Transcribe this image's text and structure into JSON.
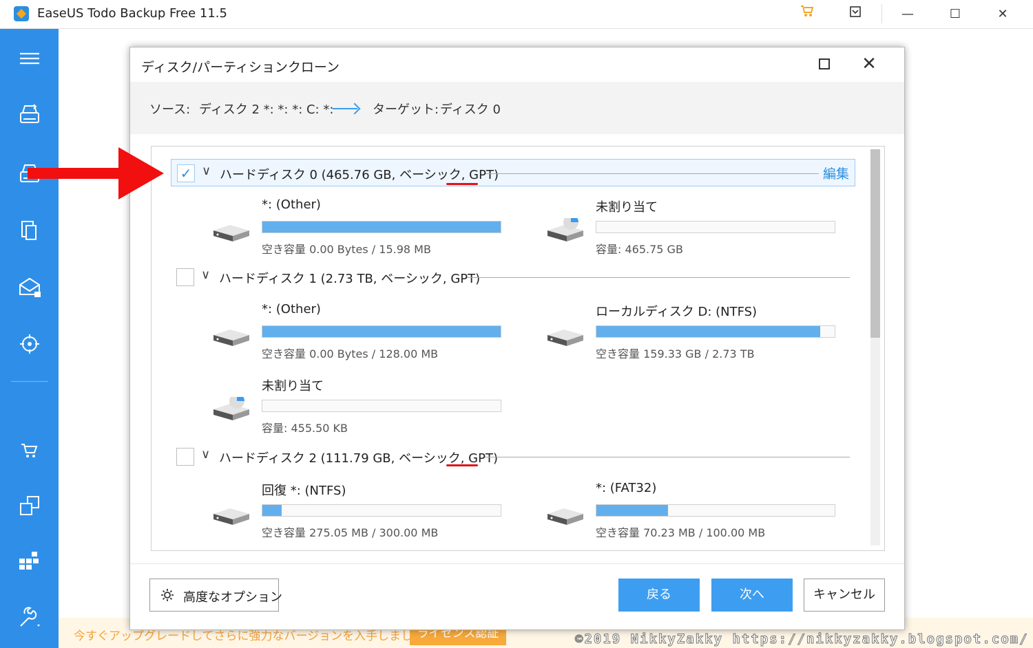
{
  "app": {
    "title": "EaseUS Todo Backup Free 11.5",
    "titlebar_icons": [
      "cart-icon",
      "dropdown-box-icon",
      "minimize-icon",
      "maximize-icon",
      "close-icon"
    ],
    "titlebar_glyphs": {
      "minimize": "—",
      "maximize": "☐",
      "close": "✕"
    }
  },
  "sidebar": {
    "items": [
      "menu-icon",
      "disk-backup-icon",
      "disk-clone-icon",
      "file-backup-icon",
      "mail-backup-icon",
      "target-icon",
      "cart-icon",
      "clone-icon",
      "system-icon",
      "tools-icon"
    ]
  },
  "banner": {
    "text": "今すぐアップグレードしてさらに強力なバージョンを入手しましょう。",
    "button": "ライセンス認証"
  },
  "watermark": "©2019 NikkyZakky https://nikkyzakky.blogspot.com/",
  "dialog": {
    "title": "ディスク/パーティションクローン",
    "source_label": "ソース:",
    "source_value": "ディスク 2 *: *: *: C: *:",
    "target_label": "ターゲット:",
    "target_value": "ディスク 0",
    "edit_label": "編集",
    "disks": [
      {
        "label": "ハードディスク 0 (465.76 GB, ベーシック, GPT)",
        "checked": true,
        "partitions": [
          {
            "name": "*: (Other)",
            "info": "空き容量 0.00 Bytes / 15.98 MB",
            "used_fraction": 1.0,
            "icon": "drive-icon"
          },
          {
            "name": "未割り当て",
            "info": "容量: 465.75 GB",
            "used_fraction": 0.0,
            "icon": "unallocated-drive-icon"
          }
        ]
      },
      {
        "label": "ハードディスク 1 (2.73 TB, ベーシック, GPT)",
        "checked": false,
        "partitions": [
          {
            "name": "*: (Other)",
            "info": "空き容量 0.00 Bytes / 128.00 MB",
            "used_fraction": 1.0,
            "icon": "drive-icon"
          },
          {
            "name": "ローカルディスク D: (NTFS)",
            "info": "空き容量 159.33 GB / 2.73 TB",
            "used_fraction": 0.94,
            "icon": "drive-icon"
          },
          {
            "name": "未割り当て",
            "info": "容量: 455.50 KB",
            "used_fraction": 0.0,
            "icon": "unallocated-drive-icon"
          }
        ]
      },
      {
        "label": "ハードディスク 2 (111.79 GB, ベーシック, GPT)",
        "checked": false,
        "partitions": [
          {
            "name": "回復 *: (NTFS)",
            "info": "空き容量 275.05 MB / 300.00 MB",
            "used_fraction": 0.08,
            "icon": "drive-icon"
          },
          {
            "name": "*: (FAT32)",
            "info": "空き容量 70.23 MB / 100.00 MB",
            "used_fraction": 0.3,
            "icon": "drive-icon"
          }
        ]
      }
    ],
    "buttons": {
      "advanced": "高度なオプション",
      "back": "戻る",
      "next": "次へ",
      "cancel": "キャンセル"
    }
  },
  "colors": {
    "sidebar": "#2f8fe8",
    "accent": "#3d9ef1",
    "bar_fill": "#62afee",
    "annotation_red": "#e01515",
    "banner_text": "#f3a33a"
  }
}
